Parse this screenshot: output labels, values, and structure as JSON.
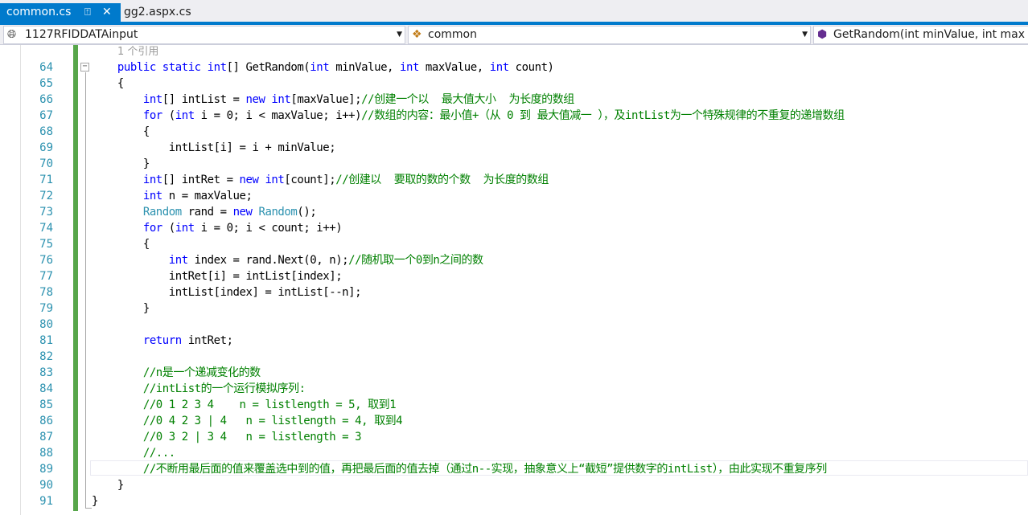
{
  "tabs": [
    {
      "label": "common.cs",
      "active": true,
      "pin_icon": "pin-icon",
      "close_icon": "close-icon"
    },
    {
      "label": "gg2.aspx.cs",
      "active": false
    }
  ],
  "nav": {
    "project": "1127RFIDDATAinput",
    "class": "common",
    "member": "GetRandom(int minValue, int max"
  },
  "codelens": "1 个引用",
  "colors": {
    "accent": "#007acc",
    "keyword": "#0000ff",
    "type": "#2b91af",
    "comment": "#008000",
    "change_bar": "#57a64a"
  },
  "lines": [
    {
      "num": "64",
      "segs": [
        [
          "",
          "    "
        ],
        [
          "k",
          "public static int"
        ],
        [
          "",
          "[] GetRandom("
        ],
        [
          "k",
          "int"
        ],
        [
          "",
          " minValue, "
        ],
        [
          "k",
          "int"
        ],
        [
          "",
          " maxValue, "
        ],
        [
          "k",
          "int"
        ],
        [
          "",
          " count)"
        ]
      ]
    },
    {
      "num": "65",
      "segs": [
        [
          "",
          "    {"
        ]
      ]
    },
    {
      "num": "66",
      "segs": [
        [
          "",
          "        "
        ],
        [
          "k",
          "int"
        ],
        [
          "",
          "[] intList = "
        ],
        [
          "k",
          "new int"
        ],
        [
          "",
          "[maxValue];"
        ],
        [
          "c",
          "//创建一个以  最大值大小  为长度的数组"
        ]
      ]
    },
    {
      "num": "67",
      "segs": [
        [
          "",
          "        "
        ],
        [
          "k",
          "for"
        ],
        [
          "",
          " ("
        ],
        [
          "k",
          "int"
        ],
        [
          "",
          " i = 0; i < maxValue; i++)"
        ],
        [
          "c",
          "//数组的内容：最小值+（从 0 到 最大值减一 ），及intList为一个特殊规律的不重复的递增数组"
        ]
      ]
    },
    {
      "num": "68",
      "segs": [
        [
          "",
          "        {"
        ]
      ]
    },
    {
      "num": "69",
      "segs": [
        [
          "",
          "            intList[i] = i + minValue;"
        ]
      ]
    },
    {
      "num": "70",
      "segs": [
        [
          "",
          "        }"
        ]
      ]
    },
    {
      "num": "71",
      "segs": [
        [
          "",
          "        "
        ],
        [
          "k",
          "int"
        ],
        [
          "",
          "[] intRet = "
        ],
        [
          "k",
          "new int"
        ],
        [
          "",
          "[count];"
        ],
        [
          "c",
          "//创建以  要取的数的个数  为长度的数组"
        ]
      ]
    },
    {
      "num": "72",
      "segs": [
        [
          "",
          "        "
        ],
        [
          "k",
          "int"
        ],
        [
          "",
          " n = maxValue;"
        ]
      ]
    },
    {
      "num": "73",
      "segs": [
        [
          "",
          "        "
        ],
        [
          "t",
          "Random"
        ],
        [
          "",
          " rand = "
        ],
        [
          "k",
          "new"
        ],
        [
          "",
          " "
        ],
        [
          "t",
          "Random"
        ],
        [
          "",
          "();"
        ]
      ]
    },
    {
      "num": "74",
      "segs": [
        [
          "",
          "        "
        ],
        [
          "k",
          "for"
        ],
        [
          "",
          " ("
        ],
        [
          "k",
          "int"
        ],
        [
          "",
          " i = 0; i < count; i++)"
        ]
      ]
    },
    {
      "num": "75",
      "segs": [
        [
          "",
          "        {"
        ]
      ]
    },
    {
      "num": "76",
      "segs": [
        [
          "",
          "            "
        ],
        [
          "k",
          "int"
        ],
        [
          "",
          " index = rand.Next(0, n);"
        ],
        [
          "c",
          "//随机取一个0到n之间的数"
        ]
      ]
    },
    {
      "num": "77",
      "segs": [
        [
          "",
          "            intRet[i] = intList[index];"
        ]
      ]
    },
    {
      "num": "78",
      "segs": [
        [
          "",
          "            intList[index] = intList[--n];"
        ]
      ]
    },
    {
      "num": "79",
      "segs": [
        [
          "",
          "        }"
        ]
      ]
    },
    {
      "num": "80",
      "segs": [
        [
          "",
          ""
        ]
      ]
    },
    {
      "num": "81",
      "segs": [
        [
          "",
          "        "
        ],
        [
          "k",
          "return"
        ],
        [
          "",
          " intRet;"
        ]
      ]
    },
    {
      "num": "82",
      "segs": [
        [
          "",
          ""
        ]
      ]
    },
    {
      "num": "83",
      "segs": [
        [
          "",
          "        "
        ],
        [
          "c",
          "//n是一个递减变化的数"
        ]
      ]
    },
    {
      "num": "84",
      "segs": [
        [
          "",
          "        "
        ],
        [
          "c",
          "//intList的一个运行模拟序列:"
        ]
      ]
    },
    {
      "num": "85",
      "segs": [
        [
          "",
          "        "
        ],
        [
          "c",
          "//0 1 2 3 4    n = listlength = 5, 取到1"
        ]
      ]
    },
    {
      "num": "86",
      "segs": [
        [
          "",
          "        "
        ],
        [
          "c",
          "//0 4 2 3 | 4   n = listlength = 4, 取到4"
        ]
      ]
    },
    {
      "num": "87",
      "segs": [
        [
          "",
          "        "
        ],
        [
          "c",
          "//0 3 2 | 3 4   n = listlength = 3"
        ]
      ]
    },
    {
      "num": "88",
      "segs": [
        [
          "",
          "        "
        ],
        [
          "c",
          "//..."
        ]
      ]
    },
    {
      "num": "89",
      "segs": [
        [
          "",
          "        "
        ],
        [
          "c",
          "//不断用最后面的值来覆盖选中到的值，再把最后面的值去掉（通过n--实现，抽象意义上“截短”提供数字的intList），由此实现不重复序列"
        ]
      ]
    },
    {
      "num": "90",
      "segs": [
        [
          "",
          "    }"
        ]
      ]
    },
    {
      "num": "91",
      "segs": [
        [
          "",
          "}"
        ]
      ]
    }
  ]
}
